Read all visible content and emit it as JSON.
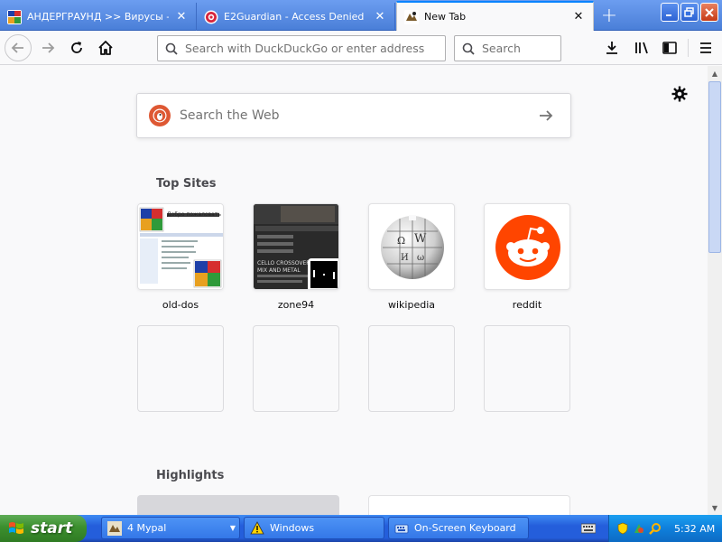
{
  "tabs": [
    {
      "title": "АНДЕРГРАУНД >> Вирусы - Ст",
      "favicon": "msdos-favicon"
    },
    {
      "title": "E2Guardian - Access Denied",
      "favicon": "e2guardian-favicon"
    },
    {
      "title": "New Tab",
      "favicon": "dos-game-favicon"
    }
  ],
  "nav": {
    "url_placeholder": "Search with DuckDuckGo or enter address",
    "search_placeholder": "Search"
  },
  "content": {
    "websearch_placeholder": "Search the Web",
    "top_sites_title": "Top Sites",
    "highlights_title": "Highlights",
    "top_sites": [
      {
        "label": "old-dos"
      },
      {
        "label": "zone94"
      },
      {
        "label": "wikipedia"
      },
      {
        "label": "reddit"
      }
    ],
    "zone94_thumb_text": "CELLO CROSSOVER MIX AND METAL",
    "msdos_text": "Добро пожаловать"
  },
  "taskbar": {
    "start_label": "start",
    "buttons": [
      {
        "label": "4 Mypal"
      },
      {
        "label": "Windows"
      },
      {
        "label": "On-Screen Keyboard"
      }
    ],
    "clock": "5:32 AM"
  },
  "colors": {
    "accent": "#0a84ff",
    "reddit": "#ff4500",
    "duckduckgo": "#de5833",
    "xp_blue": "#245edb",
    "xp_green": "#3c8f2e"
  }
}
